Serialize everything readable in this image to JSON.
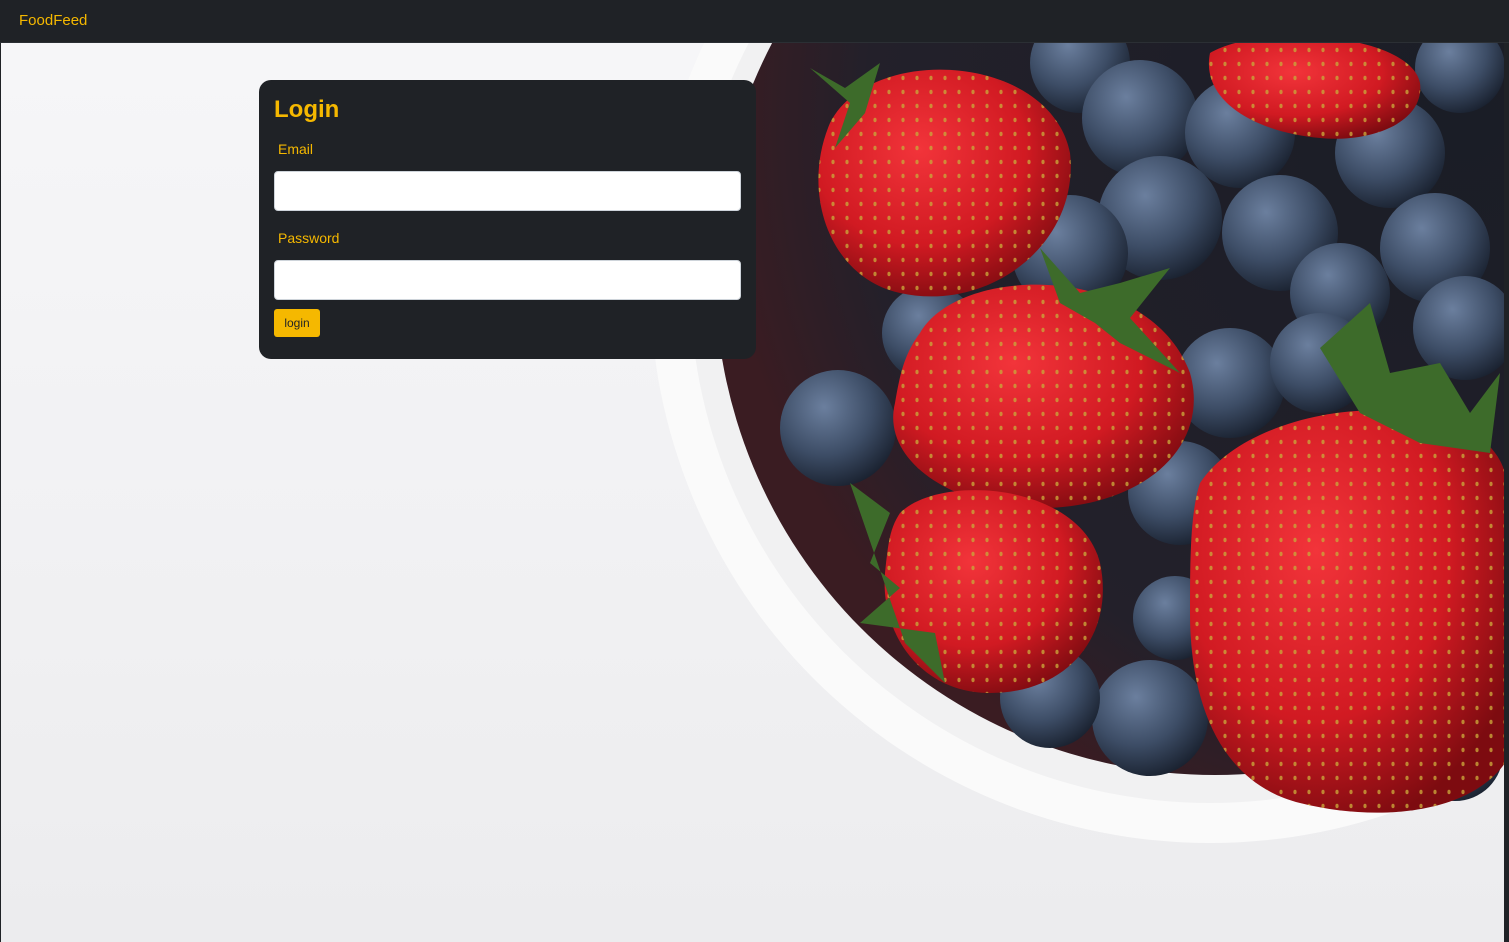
{
  "navbar": {
    "brand": "FoodFeed"
  },
  "hero": {
    "image": "strawberries-and-blueberries-bowl"
  },
  "login": {
    "title": "Login",
    "email_label": "Email",
    "email_value": "",
    "password_label": "Password",
    "password_value": "",
    "submit_label": "login"
  },
  "colors": {
    "accent": "#f5b800",
    "dark": "#1f2226",
    "background": "#f4f4f6"
  }
}
